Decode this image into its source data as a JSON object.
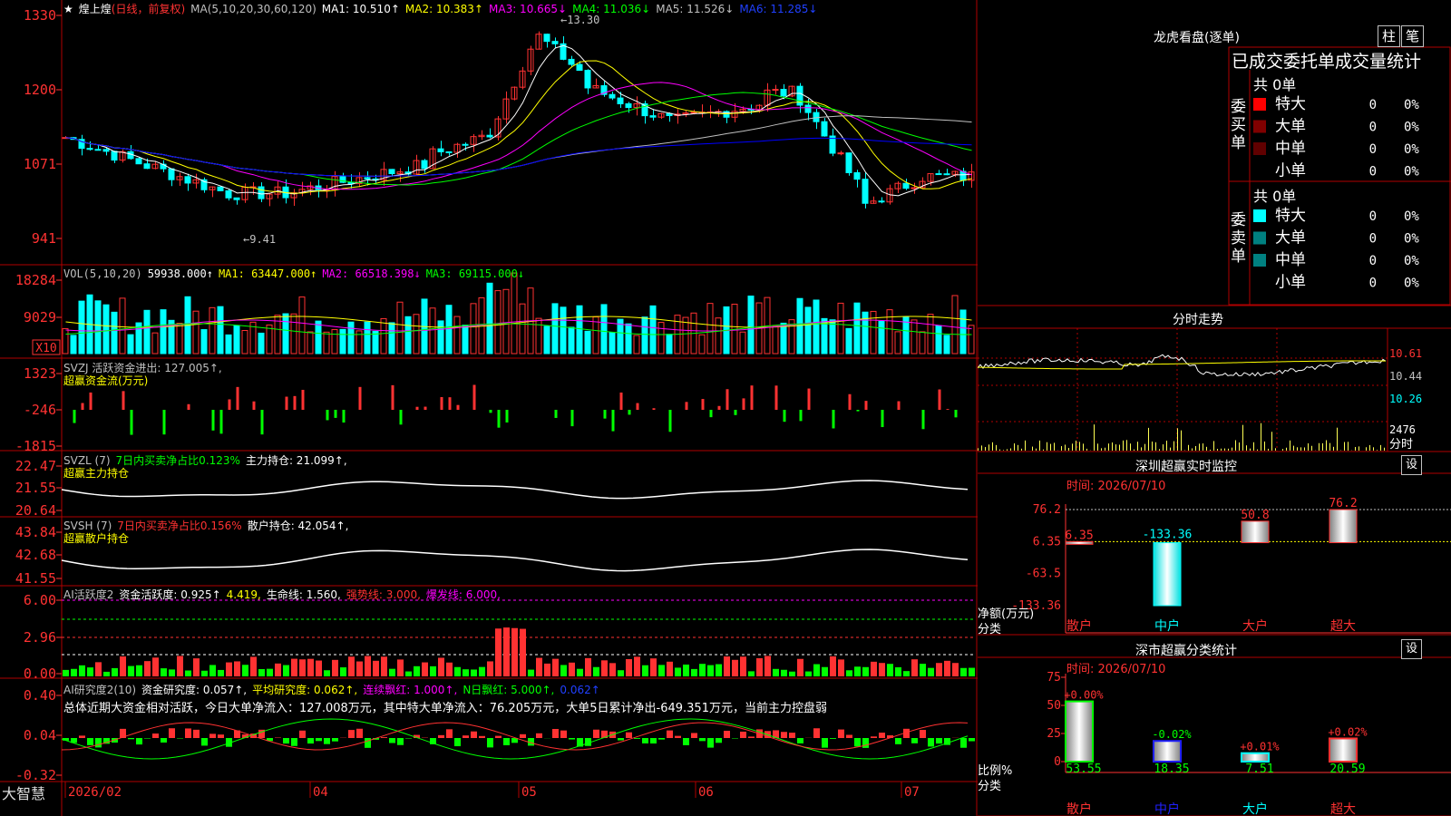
{
  "colors": {
    "up": "#ff3232",
    "down": "#00ffff",
    "ma1": "#ffffff",
    "ma2": "#ffff00",
    "ma3": "#ff00ff",
    "ma4": "#00ff00",
    "ma5": "#c0c0c0",
    "ma6": "#0000ff",
    "vol": "#ffff54",
    "grid": "#b00000"
  },
  "main": {
    "name": "煌上煌",
    "mode": "(日线，前复权)",
    "ma_label": "MA(5,10,20,30,60,120)",
    "ma1": "MA1: 10.510↑",
    "ma2": "MA2: 10.383↑",
    "ma3": "MA3: 10.665↓",
    "ma4": "MA4: 11.036↓",
    "ma5": "MA5: 11.526↓",
    "ma6": "MA6: 11.285↓",
    "y_labels": [
      "1330",
      "1200",
      "1071",
      "941"
    ],
    "high_label": "13.30",
    "low_label": "9.41"
  },
  "vol": {
    "label": "VOL(5,10,20)",
    "value": "59938.000↑",
    "ma1": "MA1: 63447.000↑",
    "ma2": "MA2: 66518.398↓",
    "ma3": "MA3: 69115.000↓",
    "y_labels": [
      "18284",
      "9029"
    ],
    "unit": "X10"
  },
  "svzj": {
    "label": "SVZJ  活跃资金进出: 127.005↑,",
    "sub": "超赢资金流(万元)",
    "y_labels": [
      "1323",
      "-246",
      "-1815"
    ]
  },
  "svzl": {
    "label": "SVZL (7)",
    "ratio": "7日内买卖净占比0.123%",
    "hold": "主力持仓: 21.099↑,",
    "sub": "超赢主力持仓",
    "y_labels": [
      "22.47",
      "21.55",
      "20.64"
    ]
  },
  "svsh": {
    "label": "SVSH (7)",
    "ratio": "7日内买卖净占比0.156%",
    "hold": "散户持仓: 42.054↑,",
    "sub": "超赢散户持仓",
    "y_labels": [
      "43.84",
      "42.68",
      "41.55"
    ]
  },
  "ai1": {
    "label": "AI活跃度2",
    "a": "资金活跃度: 0.925↑",
    "b": "4.419,",
    "c": "生命线: 1.560,",
    "d": "强势线: 3.000,",
    "e": "爆发线: 6.000,",
    "y_labels": [
      "6.00",
      "2.96",
      "0.00"
    ]
  },
  "ai2": {
    "label": "AI研究度2(10)",
    "a": "资金研究度: 0.057↑,",
    "b": "平均研究度: 0.062↑,",
    "c": "连续飘红: 1.000↑,",
    "d": "N日飘红: 5.000↑,",
    "e": "0.062↑",
    "summary": "总体近期大资金相对活跃，今日大单净流入：127.008万元，其中特大单净流入：76.205万元，大单5日累计净出-649.351万元，当前主力控盘弱",
    "y_labels": [
      "0.40",
      "0.04",
      "-0.32"
    ]
  },
  "xaxis": {
    "labels": [
      "2026/02",
      "04",
      "05",
      "06",
      "07"
    ]
  },
  "logo": "大智慧",
  "dragon": {
    "title": "龙虎看盘(逐单)",
    "btn_bar": "柱",
    "btn_pen": "笔",
    "tabs": "已成交委托单成交量统计",
    "buy": {
      "side": "委买单",
      "total": "共 0单",
      "rows": [
        {
          "name": "特大",
          "count": "0",
          "pct": "0%",
          "color": "#ff0000"
        },
        {
          "name": "大单",
          "count": "0",
          "pct": "0%",
          "color": "#800000"
        },
        {
          "name": "中单",
          "count": "0",
          "pct": "0%",
          "color": "#600000"
        },
        {
          "name": "小单",
          "count": "0",
          "pct": "0%",
          "color": ""
        }
      ]
    },
    "sell": {
      "side": "委卖单",
      "total": "共 0单",
      "rows": [
        {
          "name": "特大",
          "count": "0",
          "pct": "0%",
          "color": "#00ffff"
        },
        {
          "name": "大单",
          "count": "0",
          "pct": "0%",
          "color": "#008080"
        },
        {
          "name": "中单",
          "count": "0",
          "pct": "0%",
          "color": "#008080"
        },
        {
          "name": "小单",
          "count": "0",
          "pct": "0%",
          "color": ""
        }
      ]
    }
  },
  "intraday": {
    "title": "分时走势",
    "y_labels": [
      "10.61",
      "10.44",
      "10.26"
    ],
    "vol_labels": [
      "2476",
      "分时"
    ]
  },
  "monitor": {
    "title": "深圳超赢实时监控",
    "btn": "设",
    "time": "时间: 2026/07/10",
    "y_labels": [
      "76.2",
      "6.35",
      "-63.5",
      "-133.36"
    ],
    "unit": "净额(万元)",
    "axis": "分类",
    "bars": [
      {
        "cat": "散户",
        "value": 6.35,
        "label": "6.35"
      },
      {
        "cat": "中户",
        "value": -133.36,
        "label": "-133.36"
      },
      {
        "cat": "大户",
        "value": 50.8,
        "label": "50.8"
      },
      {
        "cat": "超大",
        "value": 76.2,
        "label": "76.2"
      }
    ]
  },
  "classify": {
    "title": "深市超赢分类统计",
    "btn": "设",
    "time": "时间: 2026/07/10",
    "y_labels": [
      "75",
      "50",
      "25",
      "0"
    ],
    "unit": "比例%",
    "axis": "分类",
    "bars": [
      {
        "cat": "散户",
        "value": 53.55,
        "change": "+0.00%",
        "label": "53.55"
      },
      {
        "cat": "中户",
        "value": 18.35,
        "change": "-0.02%",
        "label": "18.35"
      },
      {
        "cat": "大户",
        "value": 7.51,
        "change": "+0.01%",
        "label": "7.51"
      },
      {
        "cat": "超大",
        "value": 20.59,
        "change": "+0.02%",
        "label": "20.59"
      }
    ]
  }
}
